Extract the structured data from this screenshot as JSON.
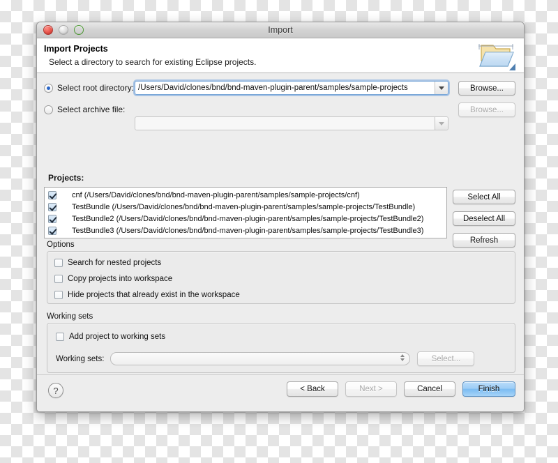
{
  "window": {
    "title": "Import",
    "traffic_lights": [
      {
        "name": "close",
        "color": "#e8534a",
        "enabled": true
      },
      {
        "name": "minimize",
        "color": "#dcdcdc",
        "enabled": false
      },
      {
        "name": "zoom",
        "color": "#63c944",
        "enabled": true
      }
    ]
  },
  "header": {
    "title": "Import Projects",
    "description": "Select a directory to search for existing Eclipse projects.",
    "icon": "import-folder-icon"
  },
  "source": {
    "root_directory": {
      "radio_label": "Select root directory:",
      "selected": true,
      "value": "/Users/David/clones/bnd/bnd-maven-plugin-parent/samples/sample-projects",
      "browse_label": "Browse...",
      "browse_enabled": true
    },
    "archive_file": {
      "radio_label": "Select archive file:",
      "selected": false,
      "value": "",
      "browse_label": "Browse...",
      "browse_enabled": false
    }
  },
  "projects": {
    "label": "Projects:",
    "items": [
      {
        "name": "cnf",
        "text": "cnf (/Users/David/clones/bnd/bnd-maven-plugin-parent/samples/sample-projects/cnf)",
        "checked": true
      },
      {
        "name": "TestBundle",
        "text": "TestBundle (/Users/David/clones/bnd/bnd-maven-plugin-parent/samples/sample-projects/TestBundle)",
        "checked": true
      },
      {
        "name": "TestBundle2",
        "text": "TestBundle2 (/Users/David/clones/bnd/bnd-maven-plugin-parent/samples/sample-projects/TestBundle2)",
        "checked": true
      },
      {
        "name": "TestBundle3",
        "text": "TestBundle3 (/Users/David/clones/bnd/bnd-maven-plugin-parent/samples/sample-projects/TestBundle3)",
        "checked": true
      }
    ],
    "side_buttons": [
      {
        "label": "Select All"
      },
      {
        "label": "Deselect All"
      },
      {
        "label": "Refresh"
      }
    ]
  },
  "options": {
    "group_title": "Options",
    "checkboxes": [
      {
        "label": "Search for nested projects",
        "checked": false
      },
      {
        "label": "Copy projects into workspace",
        "checked": false
      },
      {
        "label": "Hide projects that already exist in the workspace",
        "checked": false
      }
    ]
  },
  "working_sets": {
    "group_title": "Working sets",
    "add_checkbox": {
      "label": "Add project to working sets",
      "checked": false
    },
    "field_label": "Working sets:",
    "field_value": "",
    "select_label": "Select...",
    "select_enabled": false
  },
  "footer": {
    "help_label": "?",
    "buttons": [
      {
        "label": "< Back",
        "enabled": true,
        "default": false
      },
      {
        "label": "Next >",
        "enabled": false,
        "default": false
      },
      {
        "label": "Cancel",
        "enabled": true,
        "default": false
      },
      {
        "label": "Finish",
        "enabled": true,
        "default": true
      }
    ]
  },
  "colors": {
    "accent": "#7bbcf2",
    "window_bg": "#ededed",
    "field_bg": "#ffffff",
    "radio_dot": "#2a66c8"
  }
}
